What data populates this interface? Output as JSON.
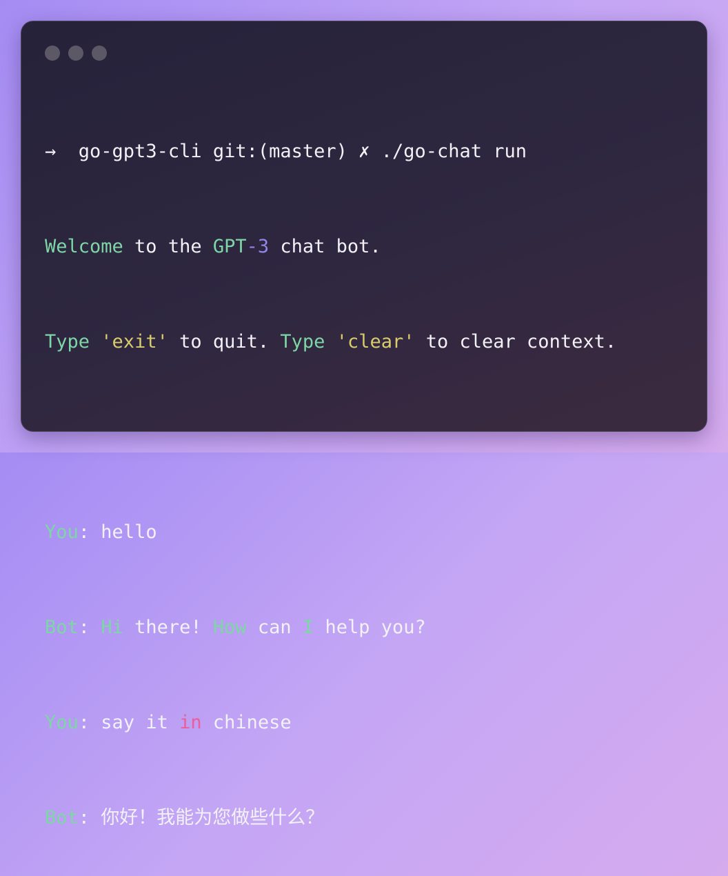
{
  "terminal": {
    "window_controls": [
      "close",
      "minimize",
      "maximize"
    ],
    "prompt": {
      "arrow": "→",
      "directory": "go-gpt3-cli",
      "git_label": "git:(master)",
      "dirty_mark": "✗",
      "command": "./go-chat run"
    },
    "welcome": {
      "w1": "Welcome",
      "w2": " to the ",
      "w3": "GPT",
      "w4": "-3",
      "w5": " chat bot."
    },
    "instructions": {
      "t1": "Type",
      "t2": " ",
      "t3": "'exit'",
      "t4": " to quit. ",
      "t5": "Type",
      "t6": " ",
      "t7": "'clear'",
      "t8": " to clear context."
    },
    "messages": [
      {
        "speaker": "You",
        "sep": ":",
        "parts": [
          " hello"
        ]
      },
      {
        "speaker": "Bot",
        "sep": ":",
        "parts": [
          " ",
          "Hi",
          " there! ",
          "How",
          " can ",
          "I",
          " help you?"
        ]
      },
      {
        "speaker": "You",
        "sep": ":",
        "parts": [
          " say it ",
          "in",
          " chinese"
        ]
      },
      {
        "speaker": "Bot",
        "sep": ":",
        "parts": [
          " 你好！我能为您做些什么？"
        ]
      }
    ]
  },
  "colors": {
    "background_start": "#a48cf3",
    "background_end": "#d6abee",
    "window": "#2a2540",
    "text": "#f2f1f6",
    "green": "#7ed6a6",
    "blue": "#8f86e8",
    "yellow": "#d9cc6c",
    "pink": "#ee5c9b"
  }
}
